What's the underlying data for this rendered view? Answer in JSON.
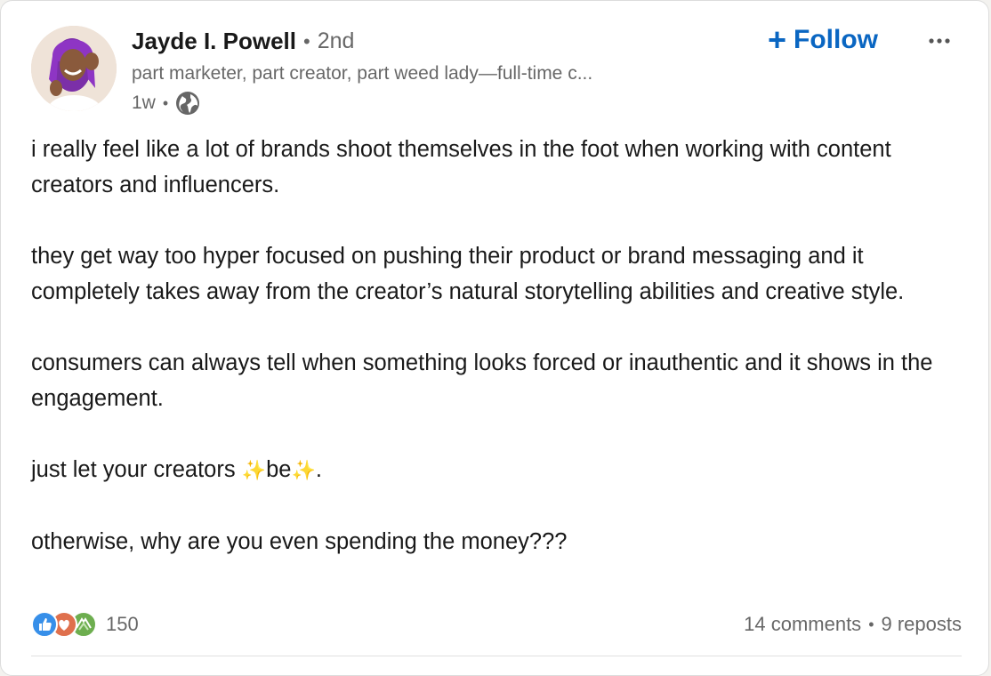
{
  "author": {
    "name": "Jayde I. Powell",
    "separator": "•",
    "degree": "2nd",
    "headline": "part marketer, part creator, part weed lady—full-time c...",
    "time": "1w",
    "time_separator": "•",
    "visibility_icon": "globe-icon",
    "avatar_icon": "profile-photo"
  },
  "actions": {
    "follow_plus": "+",
    "follow_label": "Follow",
    "more_icon": "more-horizontal-icon"
  },
  "post": {
    "paragraphs": [
      "i really feel like a lot of brands shoot themselves in the foot when working with content creators and influencers.",
      "they get way too hyper focused on pushing their product or brand messaging and it completely takes away from the creator’s natural storytelling abilities and creative style.",
      "consumers can always tell when something looks forced or inauthentic and it shows in the engagement.",
      "otherwise, why are you even spending the money???"
    ],
    "sparkle_line": {
      "before": "just let your creators ",
      "sparkle_left": "✨",
      "word": "be",
      "sparkle_right": "✨",
      "after": "."
    }
  },
  "social": {
    "reaction_icons": [
      "like-icon",
      "love-icon",
      "support-icon"
    ],
    "reaction_count": "150",
    "comments": "14 comments",
    "separator": "•",
    "reposts": "9 reposts"
  },
  "colors": {
    "accent": "#0a66c2",
    "text": "#191919",
    "muted": "#666666",
    "like": "#378fe9",
    "love": "#df704d",
    "support": "#6dae4f"
  }
}
